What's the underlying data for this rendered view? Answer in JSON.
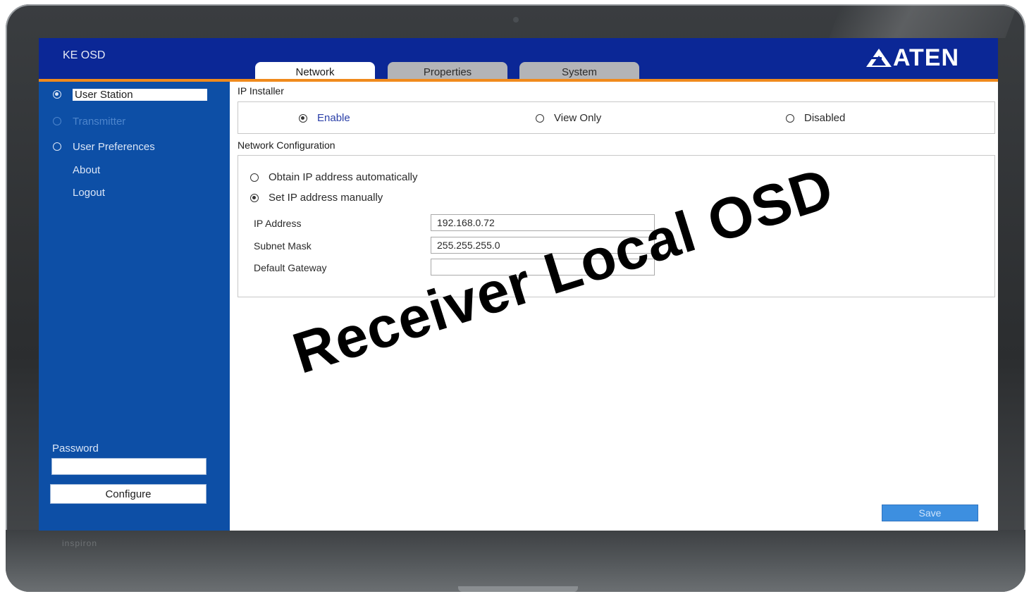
{
  "device": {
    "brand_print": "inspiron"
  },
  "app": {
    "title": "KE OSD",
    "logo": "ATEN"
  },
  "tabs": [
    {
      "label": "Network",
      "active": true
    },
    {
      "label": "Properties",
      "active": false
    },
    {
      "label": "System",
      "active": false
    }
  ],
  "sidebar": {
    "items": [
      {
        "label": "User Station",
        "selected": true
      },
      {
        "label": "Transmitter",
        "selected": false,
        "disabled": true
      },
      {
        "label": "User Preferences",
        "selected": false
      }
    ],
    "links": [
      {
        "label": "About"
      },
      {
        "label": "Logout"
      }
    ],
    "password_label": "Password",
    "password_value": "",
    "configure_label": "Configure"
  },
  "ip_installer": {
    "title": "IP Installer",
    "options": [
      {
        "label": "Enable",
        "selected": true
      },
      {
        "label": "View Only",
        "selected": false
      },
      {
        "label": "Disabled",
        "selected": false
      }
    ]
  },
  "network_config": {
    "title": "Network Configuration",
    "modes": [
      {
        "label": "Obtain IP address automatically",
        "selected": false
      },
      {
        "label": "Set IP address manually",
        "selected": true
      }
    ],
    "fields": [
      {
        "label": "IP Address",
        "value": "192.168.0.72"
      },
      {
        "label": "Subnet Mask",
        "value": "255.255.255.0"
      },
      {
        "label": "Default Gateway",
        "value": ""
      }
    ]
  },
  "save_label": "Save",
  "overlay_caption": "Receiver Local OSD",
  "colors": {
    "topbar": "#0b2796",
    "accent": "#f08a1c",
    "sidebar": "#0d4fa6",
    "save_button": "#3d8fe0"
  }
}
